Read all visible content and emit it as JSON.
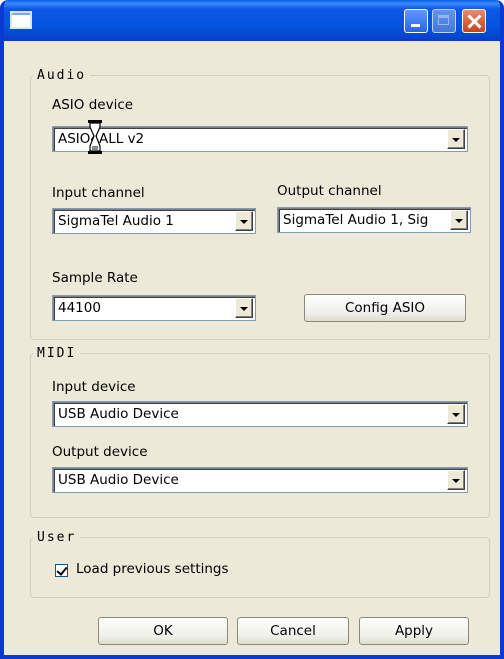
{
  "window": {
    "title": ""
  },
  "audio": {
    "legend": "Audio",
    "asio_label": "ASIO device",
    "asio_value": "ASIO4ALL v2",
    "input_label": "Input channel",
    "input_value": "SigmaTel Audio 1",
    "output_label": "Output channel",
    "output_value": "SigmaTel Audio 1, Sig",
    "rate_label": "Sample Rate",
    "rate_value": "44100",
    "config_button": "Config ASIO"
  },
  "midi": {
    "legend": "MIDI",
    "input_label": "Input device",
    "input_value": "USB Audio Device",
    "output_label": "Output device",
    "output_value": "USB Audio Device"
  },
  "user": {
    "legend": "User",
    "load_previous_label": "Load previous settings",
    "load_previous_checked": true
  },
  "footer": {
    "ok": "OK",
    "cancel": "Cancel",
    "apply": "Apply"
  }
}
